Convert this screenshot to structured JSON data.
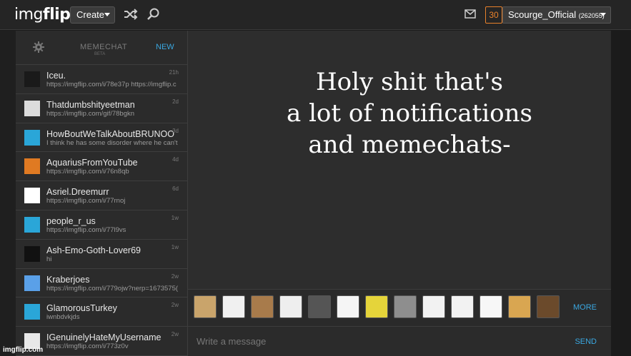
{
  "topbar": {
    "logo_img": "img",
    "logo_flip": "flip",
    "create_label": "Create",
    "shuffle_icon": "shuffle-icon",
    "search_icon": "search-icon",
    "mail_icon": "mail-icon",
    "notification_count": "30",
    "username": "Scourge_Official",
    "user_points": "(262055)"
  },
  "sidebar": {
    "title": "MEMECHAT",
    "beta": "BETA",
    "new_label": "NEW",
    "items": [
      {
        "name": "Iceu.",
        "msg": "https://imgflip.com/i/78e37p https://imgflip.c",
        "time": "21h",
        "avatar_color": "#1a1a1a"
      },
      {
        "name": "Thatdumbshityeetman",
        "msg": "https://imgflip.com/gif/78bgkn",
        "time": "2d",
        "avatar_color": "#dcdcdc"
      },
      {
        "name": "HowBoutWeTalkAboutBRUNOO",
        "msg": "I think he has some disorder where he can't",
        "time": "3d",
        "avatar_color": "#2aa6d8"
      },
      {
        "name": "AquariusFromYouTube",
        "msg": "https://imgflip.com/i/76n8qb",
        "time": "4d",
        "avatar_color": "#e07a22"
      },
      {
        "name": "Asriel.Dreemurr",
        "msg": "https://imgflip.com/i/77rnoj",
        "time": "6d",
        "avatar_color": "#ffffff"
      },
      {
        "name": "people_r_us",
        "msg": "https://imgflip.com/i/77l9vs",
        "time": "1w",
        "avatar_color": "#2aa6d8"
      },
      {
        "name": "Ash-Emo-Goth-Lover69",
        "msg": "hi",
        "time": "1w",
        "avatar_color": "#111111"
      },
      {
        "name": "Kraberjoes",
        "msg": "https://imgflip.com/i/779ojw?nerp=1673575(",
        "time": "2w",
        "avatar_color": "#5aa0e8"
      },
      {
        "name": "GlamorousTurkey",
        "msg": "iwnbdvkjds",
        "time": "2w",
        "avatar_color": "#2aa6d8"
      },
      {
        "name": "IGenuinelyHateMyUsername",
        "msg": "https://imgflip.com/i/773z0v",
        "time": "2w",
        "avatar_color": "#e8e8e8"
      }
    ]
  },
  "caption": {
    "line1": "Holy shit that's",
    "line2": "a lot of notifications",
    "line3": "and memechats-"
  },
  "reactions": {
    "more_label": "MORE",
    "items": [
      {
        "name": "doge-cat-reaction",
        "color": "#c9a46b"
      },
      {
        "name": "rage-face-reaction",
        "color": "#f0f0f0"
      },
      {
        "name": "jesus-reaction",
        "color": "#a87b4b"
      },
      {
        "name": "okay-face-reaction",
        "color": "#eeeeee"
      },
      {
        "name": "scumbag-hat-reaction",
        "color": "#555555"
      },
      {
        "name": "troll-face-reaction",
        "color": "#f5f5f5"
      },
      {
        "name": "spongebob-reaction",
        "color": "#e5d43a"
      },
      {
        "name": "pepe-reaction",
        "color": "#8e8e8e"
      },
      {
        "name": "derp-reaction",
        "color": "#f2f2f2"
      },
      {
        "name": "omg-face-reaction",
        "color": "#f2f2f2"
      },
      {
        "name": "thinking-face-reaction",
        "color": "#f7f7f7"
      },
      {
        "name": "doge-reaction",
        "color": "#d9a651"
      },
      {
        "name": "leo-toast-reaction",
        "color": "#6b4a2b"
      }
    ]
  },
  "compose": {
    "placeholder": "Write a message",
    "send_label": "SEND"
  },
  "watermark": "imgflip.com",
  "colors": {
    "accent": "#3aa7e0",
    "notification": "#e8812b"
  }
}
